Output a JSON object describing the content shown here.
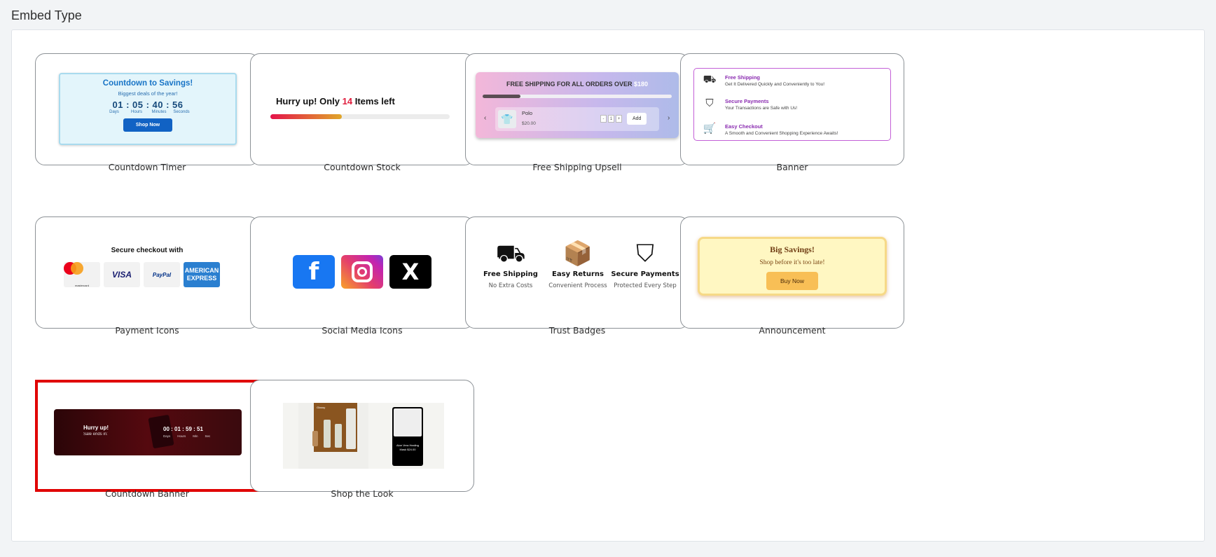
{
  "header": {
    "title": "Embed Type"
  },
  "cards": {
    "countdown_timer": {
      "label": "Countdown Timer",
      "title": "Countdown to Savings!",
      "subtitle": "Biggest deals of the year!",
      "time": "01 : 05 : 40 : 56",
      "units": [
        "Days",
        "Hours",
        "Minutes",
        "Seconds"
      ],
      "button": "Shop Now"
    },
    "countdown_stock": {
      "label": "Countdown Stock",
      "text_before": "Hurry up! Only",
      "count": "14",
      "text_after": "Items left",
      "progress": 0.4
    },
    "free_shipping": {
      "label": "Free Shipping Upsell",
      "title": "FREE SHIPPING FOR ALL ORDERS OVER",
      "threshold": "$180",
      "progress": 0.2,
      "product": "Polo",
      "price": "$20.00",
      "qty": "1",
      "add": "Add",
      "prev": "‹",
      "next": "›"
    },
    "banner": {
      "label": "Banner",
      "rows": [
        {
          "icon": "truck-icon",
          "glyph": "⛟",
          "title": "Free Shipping",
          "desc": "Get It Delivered Quickly and Conveniently to You!"
        },
        {
          "icon": "shield-check-icon",
          "glyph": "⛉",
          "title": "Secure Payments",
          "desc": "Your Transactions are Safe with Us!"
        },
        {
          "icon": "cart-icon",
          "glyph": "🛒",
          "title": "Easy Checkout",
          "desc": "A Smooth and Convenient Shopping Experience Awaits!"
        }
      ]
    },
    "payment_icons": {
      "label": "Payment Icons",
      "title": "Secure checkout with",
      "mastercard": "mastercard",
      "visa": "VISA",
      "paypal": "PayPal",
      "amex": "AMERICAN EXPRESS"
    },
    "social_media": {
      "label": "Social Media Icons",
      "facebook": "f",
      "x": "X"
    },
    "trust_badges": {
      "label": "Trust Badges",
      "badges": [
        {
          "icon": "delivery-truck-icon",
          "glyph": "⛟",
          "title": "Free Shipping",
          "desc": "No Extra Costs"
        },
        {
          "icon": "box-icon",
          "glyph": "📦",
          "title": "Easy Returns",
          "desc": "Convenient Process"
        },
        {
          "icon": "shield-check-icon",
          "glyph": "⛉",
          "title": "Secure Payments",
          "desc": "Protected Every Step"
        }
      ]
    },
    "announcement": {
      "label": "Announcement",
      "title": "Big Savings!",
      "subtitle": "Shop before it's too late!",
      "button": "Buy Now"
    },
    "countdown_banner": {
      "label": "Countdown Banner",
      "title": "Hurry up!",
      "subtitle": "Sale ends in:",
      "time": "00 : 01 : 59 : 51",
      "units": [
        "Days",
        "Hours",
        "Min",
        "Sec"
      ]
    },
    "shop_the_look": {
      "label": "Shop the Look",
      "brand": "Glossy",
      "card_text": "Aloe Vera Healing Mask $24.00"
    }
  },
  "colors": {
    "accent_red": "#e00000",
    "card_border": "#8c9196"
  }
}
